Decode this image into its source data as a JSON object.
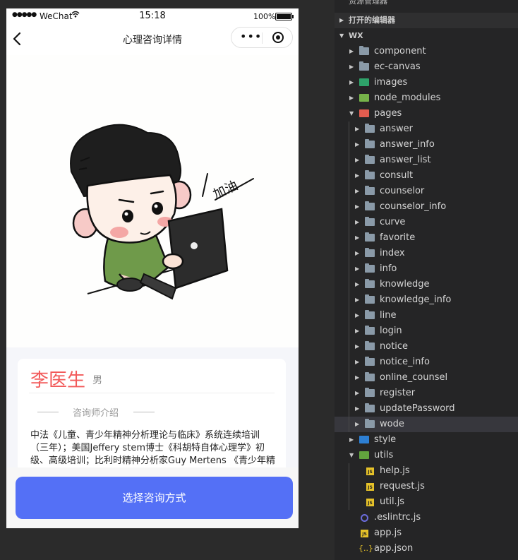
{
  "status_bar": {
    "signal": "●●●●●",
    "carrier": "WeChat",
    "time": "15:18",
    "battery": "100%"
  },
  "navbar": {
    "title": "心理咨询详情",
    "more_glyph": "•••"
  },
  "illustration": {
    "caption": "加油"
  },
  "doctor": {
    "name": "李医生",
    "gender": "男",
    "intro_title": "咨询师介绍",
    "intro_text": "中法《儿童、青少年精神分析理论与临床》系统连续培训（三年）；美国Jeffery stem博士《科胡特自体心理学》初级、高级培训；比利时精神分析家Guy Mertens 《青少年精神"
  },
  "actions": {
    "primary": "选择咨询方式"
  },
  "explorer": {
    "title": "资源管理器",
    "more": "···",
    "open_editors": "打开的编辑器",
    "root": "WX",
    "folders_top": [
      "component",
      "ec-canvas",
      "images",
      "node_modules",
      "pages"
    ],
    "pages_children": [
      "answer",
      "answer_info",
      "answer_list",
      "consult",
      "counselor",
      "counselor_info",
      "curve",
      "favorite",
      "index",
      "info",
      "knowledge",
      "knowledge_info",
      "line",
      "login",
      "notice",
      "notice_info",
      "online_counsel",
      "register",
      "updatePassword",
      "wode"
    ],
    "style": "style",
    "utils": "utils",
    "utils_children": [
      "help.js",
      "request.js",
      "util.js"
    ],
    "root_files": [
      ".eslintrc.js",
      "app.js",
      "app.json"
    ],
    "selected": "wode",
    "js_badge": "JS",
    "json_badge": "{..}"
  }
}
